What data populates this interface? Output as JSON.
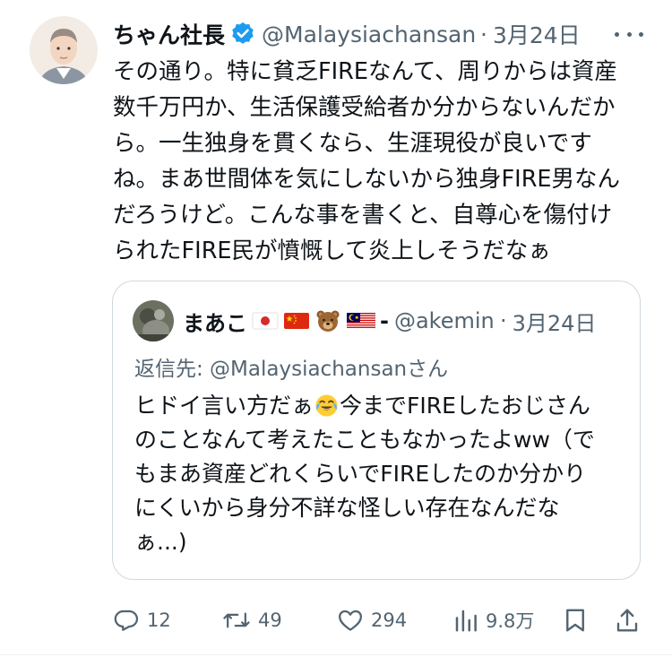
{
  "tweet": {
    "author_name": "ちゃん社長",
    "author_handle": "@Malaysiachansan",
    "separator": "·",
    "date": "3月24日",
    "verified": true,
    "body_lines": [
      "その通り。特に貧乏FIREなんて、周りからは資産",
      "数千万円か、生活保護受給者か分からないんだか",
      "ら。一生独身を貫くなら、生涯現役が良いです",
      "ね。まあ世間体を気にしないから独身FIRE男なん",
      "だろうけど。こんな事を書くと、自尊心を傷付け",
      "られたFIRE民が憤慨して炎上しそうだなぁ"
    ]
  },
  "quote": {
    "author_name": "まあこ",
    "author_name_emojis": [
      "flag-japan",
      "flag-china",
      "bear-face",
      "flag-malaysia"
    ],
    "author_name_trailing": "-",
    "author_handle": "@akemin",
    "separator": "·",
    "date": "3月24日",
    "replying_to": "返信先: @Malaysiachansanさん",
    "line1_before": "ヒドイ言い方だぁ",
    "line1_emoji": "face-with-tears-of-joy",
    "line1_after": "今までFIREしたおじさん",
    "body_lines": [
      "のことなんて考えたこともなかったよww（で",
      "もまあ資産どれくらいでFIREしたのか分かり",
      "にくいから身分不詳な怪しい存在なんだな",
      "ぁ...)"
    ]
  },
  "actions": {
    "replies": "12",
    "reposts": "49",
    "likes": "294",
    "views": "9.8万"
  },
  "colors": {
    "text": "#0f1419",
    "secondary": "#536471",
    "verified": "#1d9bf0",
    "border": "#cfd9de"
  }
}
